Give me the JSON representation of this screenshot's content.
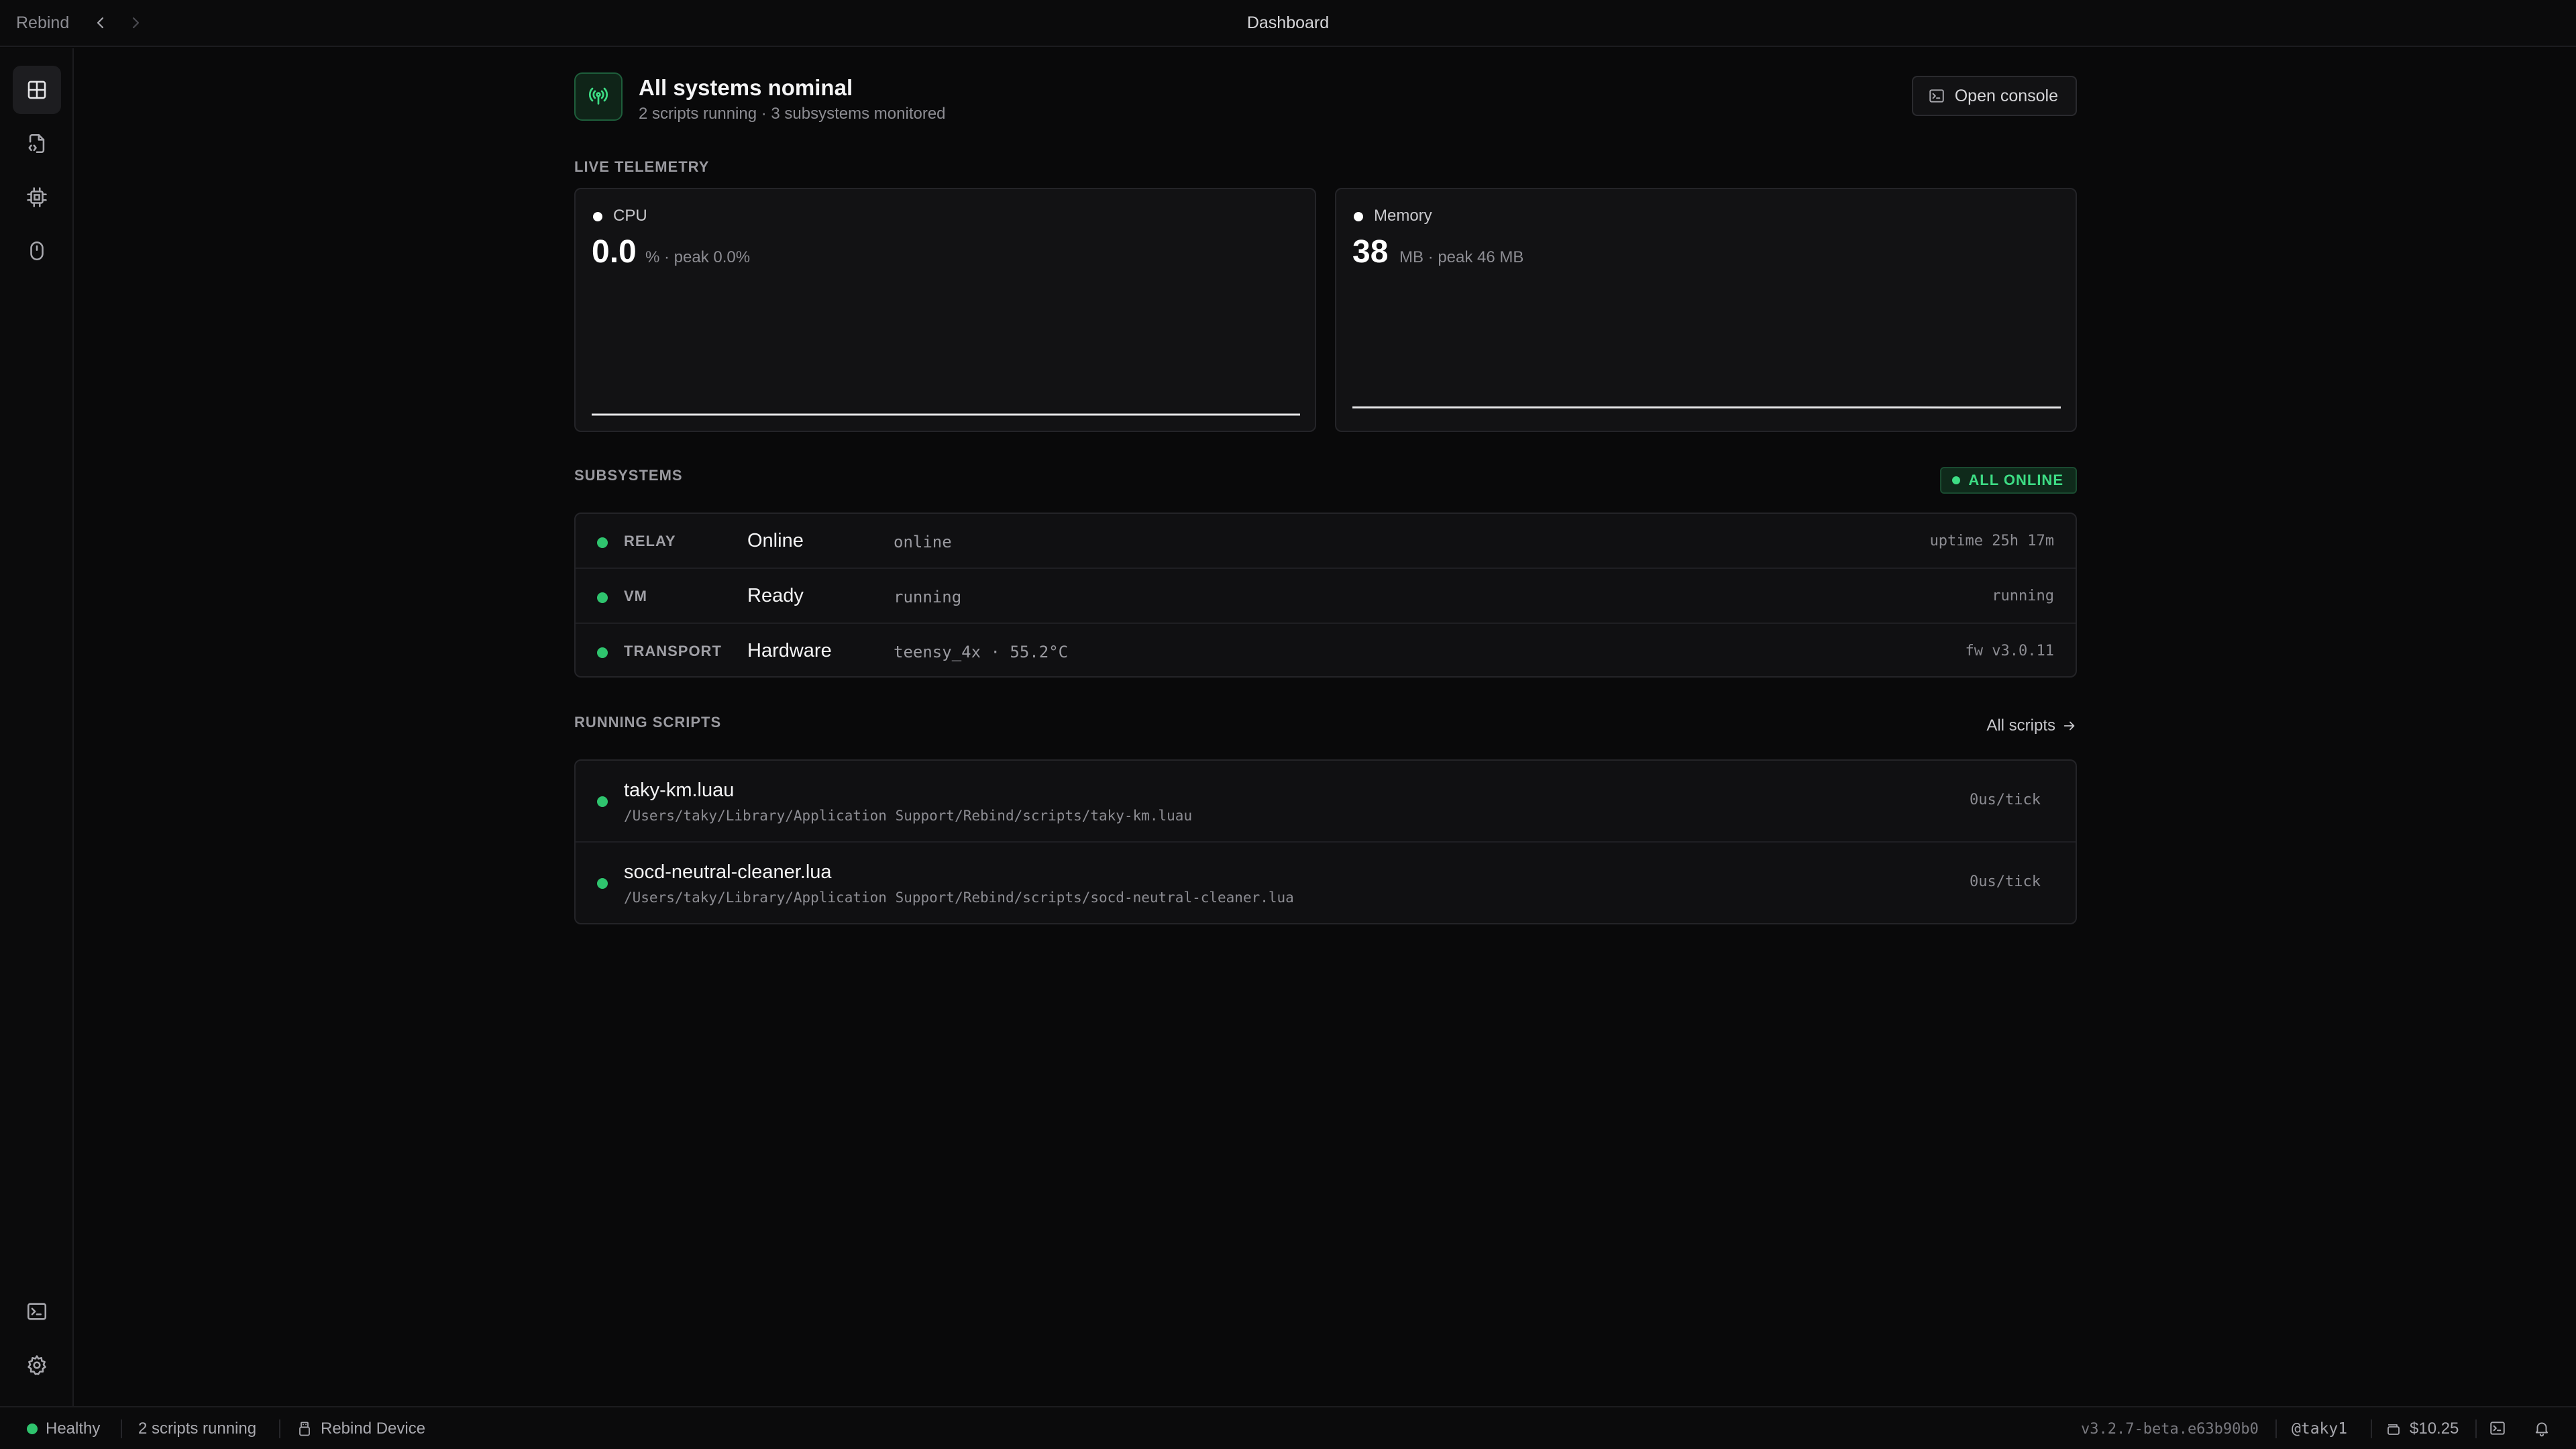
{
  "titlebar": {
    "brand": "Rebind",
    "title": "Dashboard"
  },
  "sidebar": {
    "items": [
      {
        "icon": "grid-icon",
        "active": true
      },
      {
        "icon": "script-file-icon",
        "active": false
      },
      {
        "icon": "chip-icon",
        "active": false
      },
      {
        "icon": "mouse-icon",
        "active": false
      }
    ],
    "bottom": [
      {
        "icon": "terminal-icon"
      },
      {
        "icon": "gear-icon"
      }
    ]
  },
  "header": {
    "title": "All systems nominal",
    "subtitle": "2 scripts running · 3 subsystems monitored",
    "console_label": "Open console"
  },
  "telemetry": {
    "section_label": "LIVE TELEMETRY",
    "cpu": {
      "label": "CPU",
      "value": "0.0",
      "unit_text": "% · peak 0.0%",
      "spark": [
        0,
        0,
        0,
        0,
        0,
        0,
        0,
        0,
        0,
        0,
        0,
        0
      ]
    },
    "memory": {
      "label": "Memory",
      "value": "38",
      "unit_text": "MB · peak 46 MB",
      "spark": [
        38,
        38,
        38,
        38,
        38,
        38,
        38,
        38,
        38,
        38,
        38,
        38,
        38,
        38,
        38,
        38,
        37.6,
        37.5,
        37.5,
        37.5
      ]
    }
  },
  "subsystems": {
    "section_label": "SUBSYSTEMS",
    "badge": "ALL ONLINE",
    "rows": [
      {
        "key": "RELAY",
        "state": "Online",
        "detail": "online",
        "right": "uptime 25h 17m"
      },
      {
        "key": "VM",
        "state": "Ready",
        "detail": "running",
        "right": "running"
      },
      {
        "key": "TRANSPORT",
        "state": "Hardware",
        "detail": "teensy_4x · 55.2°C",
        "right": "fw v3.0.11"
      }
    ]
  },
  "scripts": {
    "section_label": "RUNNING SCRIPTS",
    "all_link": "All scripts",
    "rows": [
      {
        "name": "taky-km.luau",
        "path": "/Users/taky/Library/Application Support/Rebind/scripts/taky-km.luau",
        "tick": "0us/tick"
      },
      {
        "name": "socd-neutral-cleaner.lua",
        "path": "/Users/taky/Library/Application Support/Rebind/scripts/socd-neutral-cleaner.lua",
        "tick": "0us/tick"
      }
    ]
  },
  "statusbar": {
    "health": "Healthy",
    "scripts": "2 scripts running",
    "device": "Rebind Device",
    "version": "v3.2.7-beta.e63b90b0",
    "user": "@taky1",
    "balance": "$10.25"
  },
  "colors": {
    "accent_green": "#2fc46e",
    "background": "#09090a",
    "card": "#121214"
  }
}
